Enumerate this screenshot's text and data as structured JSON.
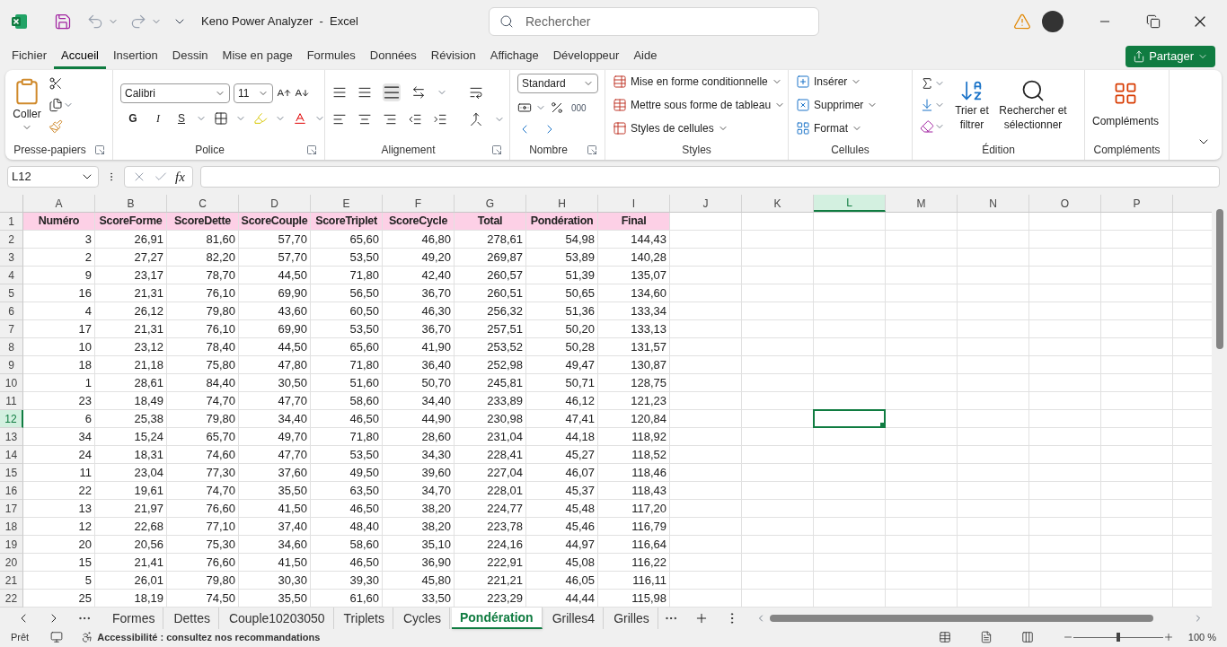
{
  "title_bar": {
    "title": "Keno Power Analyzer  -  Excel",
    "search": {
      "placeholder": "Rechercher"
    }
  },
  "menu_tabs": [
    {
      "label": "Fichier",
      "selected": false
    },
    {
      "label": "Accueil",
      "selected": true
    },
    {
      "label": "Insertion",
      "selected": false
    },
    {
      "label": "Dessin",
      "selected": false
    },
    {
      "label": "Mise en page",
      "selected": false
    },
    {
      "label": "Formules",
      "selected": false
    },
    {
      "label": "Données",
      "selected": false
    },
    {
      "label": "Révision",
      "selected": false
    },
    {
      "label": "Affichage",
      "selected": false
    },
    {
      "label": "Développeur",
      "selected": false
    },
    {
      "label": "Aide",
      "selected": false
    }
  ],
  "share_button": "Partager",
  "ribbon": {
    "clipboard": {
      "label": "Presse-papiers",
      "paste": "Coller"
    },
    "font": {
      "label": "Police",
      "font_name": "Calibri",
      "font_size": "11",
      "bold": "G",
      "italic": "I",
      "underline": "S"
    },
    "alignment": {
      "label": "Alignement"
    },
    "number": {
      "label": "Nombre",
      "format": "Standard",
      "thousands": "000"
    },
    "styles": {
      "label": "Styles",
      "items": [
        "Mise en forme conditionnelle",
        "Mettre sous forme de tableau",
        "Styles de cellules"
      ]
    },
    "cells": {
      "label": "Cellules",
      "items": [
        "Insérer",
        "Supprimer",
        "Format"
      ]
    },
    "editing": {
      "label": "Édition",
      "sort": "Trier et filtrer",
      "find": "Rechercher et sélectionner"
    },
    "addins": {
      "label": "Compléments",
      "button": "Compléments"
    }
  },
  "formula_bar": {
    "name_box": "L12",
    "fx": "fx"
  },
  "sheet": {
    "columns": [
      {
        "label": "A",
        "selected": false
      },
      {
        "label": "B",
        "selected": false
      },
      {
        "label": "C",
        "selected": false
      },
      {
        "label": "D",
        "selected": false
      },
      {
        "label": "E",
        "selected": false
      },
      {
        "label": "F",
        "selected": false
      },
      {
        "label": "G",
        "selected": false
      },
      {
        "label": "H",
        "selected": false
      },
      {
        "label": "I",
        "selected": false
      },
      {
        "label": "J",
        "selected": false
      },
      {
        "label": "K",
        "selected": false
      },
      {
        "label": "L",
        "selected": true
      },
      {
        "label": "M",
        "selected": false
      },
      {
        "label": "N",
        "selected": false
      },
      {
        "label": "O",
        "selected": false
      },
      {
        "label": "P",
        "selected": false
      }
    ],
    "rows": [
      {
        "label": "1",
        "selected": false,
        "kind": "header",
        "cells": [
          "Numéro",
          "ScoreForme",
          "ScoreDette",
          "ScoreCouple",
          "ScoreTriplet",
          "ScoreCycle",
          "Total",
          "Pondération",
          "Final"
        ]
      },
      {
        "label": "2",
        "selected": false,
        "kind": "data",
        "cells": [
          "3",
          "26,91",
          "81,60",
          "57,70",
          "65,60",
          "46,80",
          "278,61",
          "54,98",
          "144,43"
        ]
      },
      {
        "label": "3",
        "selected": false,
        "kind": "data",
        "cells": [
          "2",
          "27,27",
          "82,20",
          "57,70",
          "53,50",
          "49,20",
          "269,87",
          "53,89",
          "140,28"
        ]
      },
      {
        "label": "4",
        "selected": false,
        "kind": "data",
        "cells": [
          "9",
          "23,17",
          "78,70",
          "44,50",
          "71,80",
          "42,40",
          "260,57",
          "51,39",
          "135,07"
        ]
      },
      {
        "label": "5",
        "selected": false,
        "kind": "data",
        "cells": [
          "16",
          "21,31",
          "76,10",
          "69,90",
          "56,50",
          "36,70",
          "260,51",
          "50,65",
          "134,60"
        ]
      },
      {
        "label": "6",
        "selected": false,
        "kind": "data",
        "cells": [
          "4",
          "26,12",
          "79,80",
          "43,60",
          "60,50",
          "46,30",
          "256,32",
          "51,36",
          "133,34"
        ]
      },
      {
        "label": "7",
        "selected": false,
        "kind": "data",
        "cells": [
          "17",
          "21,31",
          "76,10",
          "69,90",
          "53,50",
          "36,70",
          "257,51",
          "50,20",
          "133,13"
        ]
      },
      {
        "label": "8",
        "selected": false,
        "kind": "data",
        "cells": [
          "10",
          "23,12",
          "78,40",
          "44,50",
          "65,60",
          "41,90",
          "253,52",
          "50,28",
          "131,57"
        ]
      },
      {
        "label": "9",
        "selected": false,
        "kind": "data",
        "cells": [
          "18",
          "21,18",
          "75,80",
          "47,80",
          "71,80",
          "36,40",
          "252,98",
          "49,47",
          "130,87"
        ]
      },
      {
        "label": "10",
        "selected": false,
        "kind": "data",
        "cells": [
          "1",
          "28,61",
          "84,40",
          "30,50",
          "51,60",
          "50,70",
          "245,81",
          "50,71",
          "128,75"
        ]
      },
      {
        "label": "11",
        "selected": false,
        "kind": "data",
        "cells": [
          "23",
          "18,49",
          "74,70",
          "47,70",
          "58,60",
          "34,40",
          "233,89",
          "46,12",
          "121,23"
        ]
      },
      {
        "label": "12",
        "selected": true,
        "kind": "data",
        "cells": [
          "6",
          "25,38",
          "79,80",
          "34,40",
          "46,50",
          "44,90",
          "230,98",
          "47,41",
          "120,84"
        ]
      },
      {
        "label": "13",
        "selected": false,
        "kind": "data",
        "cells": [
          "34",
          "15,24",
          "65,70",
          "49,70",
          "71,80",
          "28,60",
          "231,04",
          "44,18",
          "118,92"
        ]
      },
      {
        "label": "14",
        "selected": false,
        "kind": "data",
        "cells": [
          "24",
          "18,31",
          "74,60",
          "47,70",
          "53,50",
          "34,30",
          "228,41",
          "45,27",
          "118,52"
        ]
      },
      {
        "label": "15",
        "selected": false,
        "kind": "data",
        "cells": [
          "11",
          "23,04",
          "77,30",
          "37,60",
          "49,50",
          "39,60",
          "227,04",
          "46,07",
          "118,46"
        ]
      },
      {
        "label": "16",
        "selected": false,
        "kind": "data",
        "cells": [
          "22",
          "19,61",
          "74,70",
          "35,50",
          "63,50",
          "34,70",
          "228,01",
          "45,37",
          "118,43"
        ]
      },
      {
        "label": "17",
        "selected": false,
        "kind": "data",
        "cells": [
          "13",
          "21,97",
          "76,60",
          "41,50",
          "46,50",
          "38,20",
          "224,77",
          "45,48",
          "117,20"
        ]
      },
      {
        "label": "18",
        "selected": false,
        "kind": "data",
        "cells": [
          "12",
          "22,68",
          "77,10",
          "37,40",
          "48,40",
          "38,20",
          "223,78",
          "45,46",
          "116,79"
        ]
      },
      {
        "label": "19",
        "selected": false,
        "kind": "data",
        "cells": [
          "20",
          "20,56",
          "75,30",
          "34,60",
          "58,60",
          "35,10",
          "224,16",
          "44,97",
          "116,64"
        ]
      },
      {
        "label": "20",
        "selected": false,
        "kind": "data",
        "cells": [
          "15",
          "21,41",
          "76,60",
          "41,50",
          "46,50",
          "36,90",
          "222,91",
          "45,08",
          "116,22"
        ]
      },
      {
        "label": "21",
        "selected": false,
        "kind": "data",
        "cells": [
          "5",
          "26,01",
          "79,80",
          "30,30",
          "39,30",
          "45,80",
          "221,21",
          "46,05",
          "116,11"
        ]
      },
      {
        "label": "22",
        "selected": false,
        "kind": "data",
        "cells": [
          "25",
          "18,19",
          "74,50",
          "35,50",
          "61,60",
          "33,50",
          "223,29",
          "44,44",
          "115,98"
        ]
      }
    ]
  },
  "sheet_tabs": [
    {
      "label": "Formes",
      "selected": false
    },
    {
      "label": "Dettes",
      "selected": false
    },
    {
      "label": "Couple10203050",
      "selected": false
    },
    {
      "label": "Triplets",
      "selected": false
    },
    {
      "label": "Cycles",
      "selected": false
    },
    {
      "label": "Pondération",
      "selected": true
    },
    {
      "label": "Grilles4",
      "selected": false
    },
    {
      "label": "Grilles",
      "selected": false
    }
  ],
  "status_bar": {
    "mode": "Prêt",
    "accessibility": "Accessibilité : consultez nos recommandations",
    "zoom": "100 %",
    "zoom_slider": {
      "level": 0.5
    }
  }
}
